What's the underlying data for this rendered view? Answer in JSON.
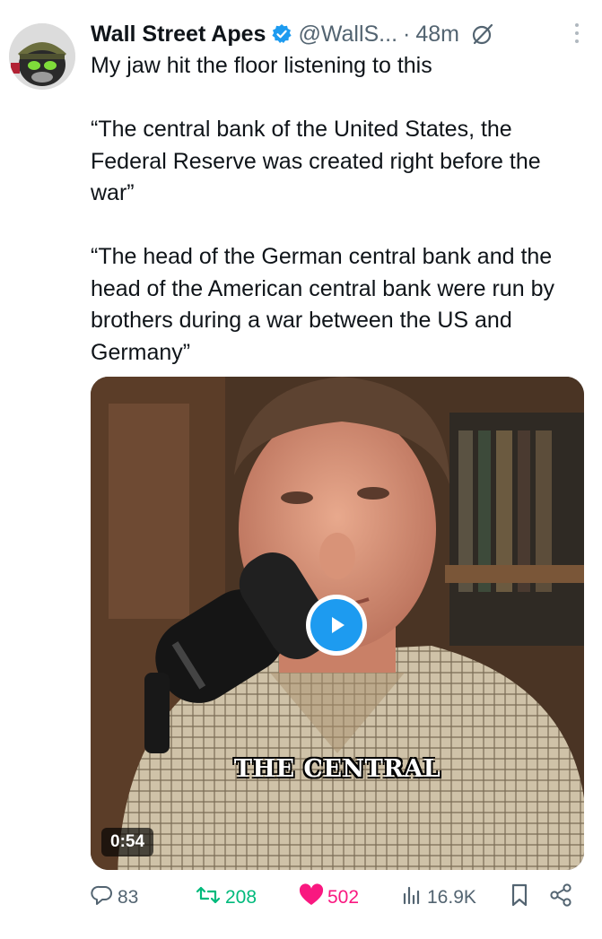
{
  "tweet": {
    "author_name": "Wall Street Apes",
    "author_handle": "@WallS...",
    "separator": "·",
    "timestamp": "48m",
    "paragraphs": [
      "My jaw hit the floor listening to this",
      "“The central bank of the United States, the Federal Reserve was created right before the war”",
      "“The head of the German central bank and the head of the American central bank were run by brothers during a war between the US and Germany”"
    ]
  },
  "media": {
    "caption": "THE CENTRAL",
    "duration": "0:54"
  },
  "actions": {
    "replies": "83",
    "retweets": "208",
    "likes": "502",
    "views": "16.9K"
  },
  "icons": {
    "verified": "verified-badge-icon",
    "grok": "grok-icon",
    "more": "more-options-icon",
    "play": "play-icon",
    "reply": "reply-icon",
    "retweet": "retweet-icon",
    "like": "heart-icon",
    "views": "views-icon",
    "bookmark": "bookmark-icon",
    "share": "share-icon"
  },
  "colors": {
    "verified": "#1d9bf0",
    "retweet": "#00ba7c",
    "like": "#f91880",
    "muted": "#536471"
  }
}
